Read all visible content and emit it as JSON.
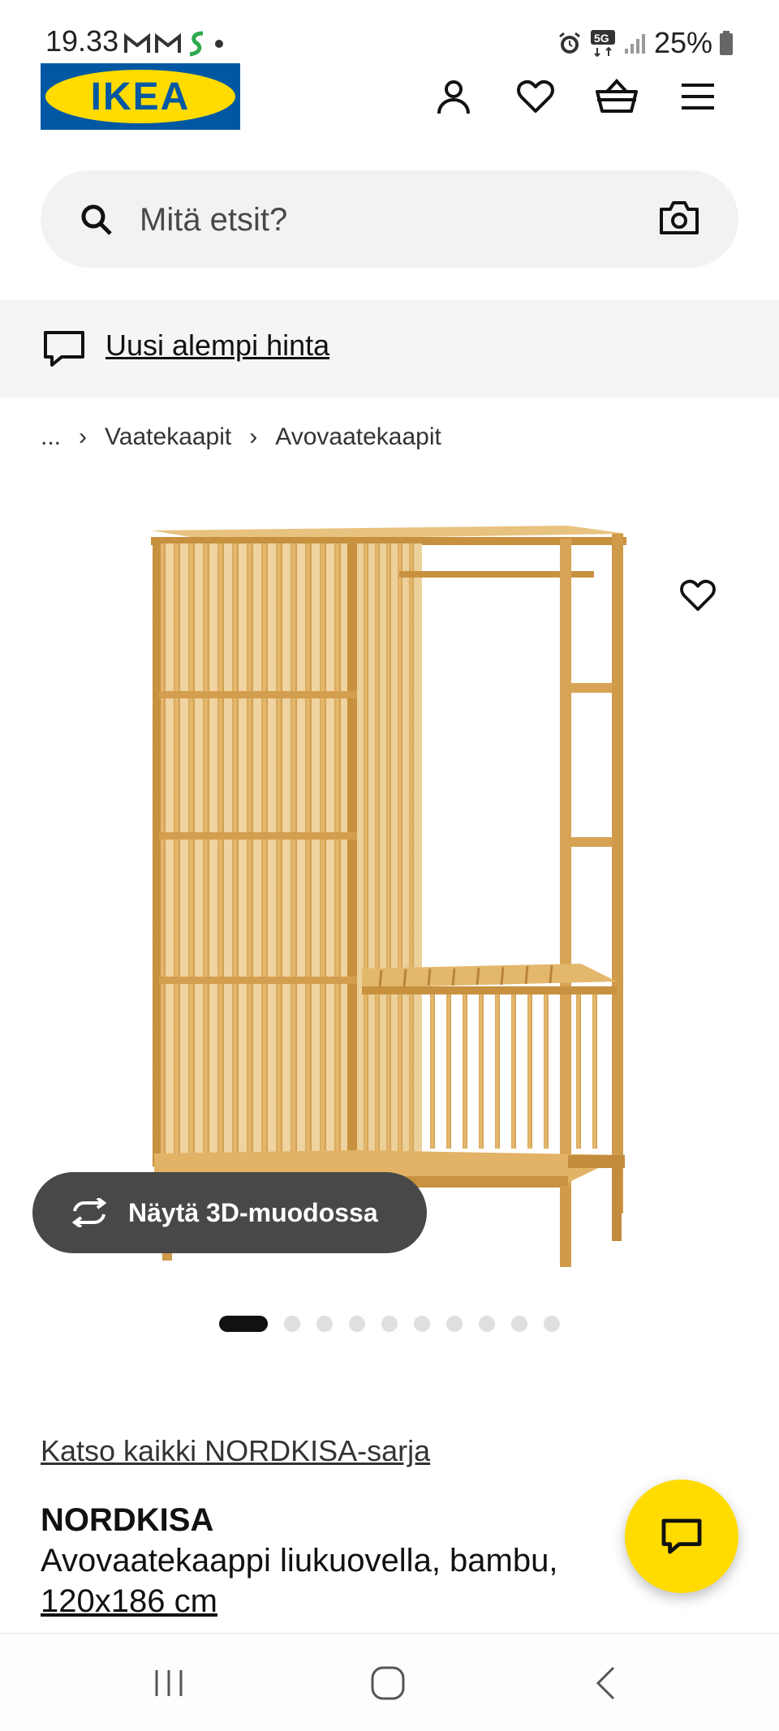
{
  "status_bar": {
    "time": "19.33",
    "battery": "25%",
    "network": "5G"
  },
  "header": {
    "logo_text": "IKEA",
    "brand_colors": {
      "blue": "#0058a3",
      "yellow": "#ffdb00"
    },
    "icons": [
      "user-icon",
      "heart-icon",
      "basket-icon",
      "menu-icon"
    ]
  },
  "search": {
    "placeholder": "Mitä etsit?"
  },
  "promo": {
    "text": "Uusi alempi hinta"
  },
  "breadcrumb": {
    "ellipsis": "...",
    "items": [
      "Vaatekaapit",
      "Avovaatekaapit"
    ]
  },
  "product_image": {
    "view_3d_label": "Näytä 3D-muodossa",
    "carousel": {
      "total": 10,
      "active": 1
    }
  },
  "product": {
    "series_link": "Katso kaikki NORDKISA-sarja",
    "name": "NORDKISA",
    "description": "Avovaatekaappi liukuovella, bambu,",
    "size": "120x186 cm"
  }
}
